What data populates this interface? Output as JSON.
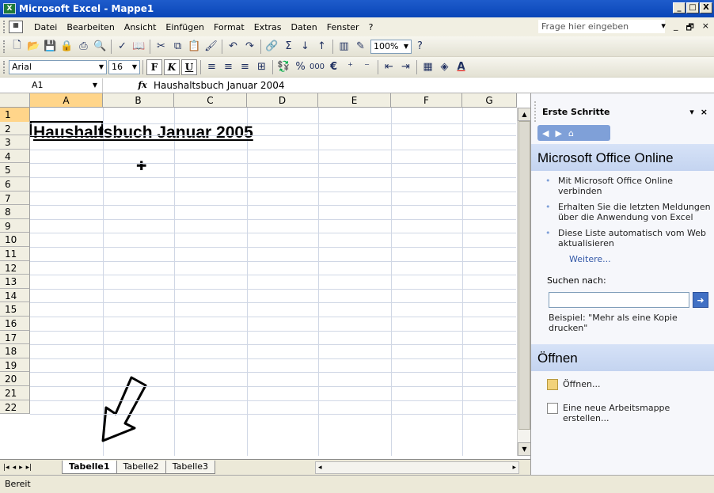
{
  "window": {
    "title": "Microsoft Excel - Mappe1",
    "app_icon": "excel-icon",
    "controls": [
      "_",
      "□",
      "X"
    ]
  },
  "menubar": {
    "items": [
      "Datei",
      "Bearbeiten",
      "Ansicht",
      "Einfügen",
      "Format",
      "Extras",
      "Daten",
      "Fenster",
      "?"
    ],
    "help_placeholder": "Frage hier eingeben",
    "doc_controls": [
      "▾",
      "_",
      "🗗",
      "×"
    ]
  },
  "standard_toolbar": {
    "icons": [
      "new-icon",
      "open-icon",
      "save-icon",
      "permission-icon",
      "print-icon",
      "print-preview-icon",
      "spelling-icon",
      "research-icon",
      "cut-icon",
      "copy-icon",
      "paste-icon",
      "format-painter-icon",
      "undo-icon",
      "redo-icon",
      "hyperlink-icon",
      "autosum-icon",
      "sort-asc-icon",
      "sort-desc-icon",
      "chart-wizard-icon",
      "drawing-icon",
      "help-icon"
    ],
    "zoom": "100%"
  },
  "format_toolbar": {
    "font": "Arial",
    "size": "16",
    "bold": "F",
    "italic": "K",
    "underline": "U",
    "percent": "%",
    "thousands": "000",
    "euro": "€",
    "font_color": "A"
  },
  "formula_bar": {
    "cell_ref": "A1",
    "fx": "fx",
    "content": "Haushaltsbuch Januar 2004"
  },
  "sheet": {
    "columns": [
      "A",
      "B",
      "C",
      "D",
      "E",
      "F",
      "G"
    ],
    "rows": [
      "1",
      "2",
      "3",
      "4",
      "5",
      "6",
      "7",
      "8",
      "9",
      "10",
      "11",
      "12",
      "13",
      "14",
      "15",
      "16",
      "17",
      "18",
      "19",
      "20",
      "21",
      "22"
    ],
    "a1_value": "Haushaltsbuch Januar 2005"
  },
  "tabs": {
    "nav": [
      "|◂",
      "◂",
      "▸",
      "▸|"
    ],
    "sheets": [
      "Tabelle1",
      "Tabelle2",
      "Tabelle3"
    ],
    "active": "Tabelle1"
  },
  "status": {
    "text": "Bereit"
  },
  "task_pane": {
    "title": "Erste Schritte",
    "section1_title": "Microsoft Office Online",
    "bullets": [
      "Mit Microsoft Office Online verbinden",
      "Erhalten Sie die letzten Meldungen über die Anwendung von Excel",
      "Diese Liste automatisch vom Web aktualisieren"
    ],
    "more": "Weitere...",
    "search_label": "Suchen nach:",
    "search_value": "",
    "example": "Beispiel: \"Mehr als eine Kopie drucken\"",
    "section2_title": "Öffnen",
    "open_link": "Öffnen...",
    "new_link": "Eine neue Arbeitsmappe erstellen..."
  }
}
